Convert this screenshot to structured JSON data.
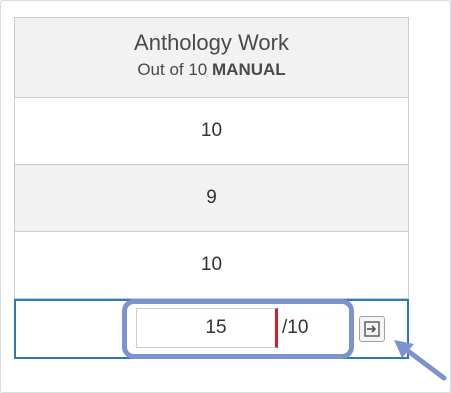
{
  "column": {
    "title": "Anthology Work",
    "subtitle_prefix": "Out of 10",
    "subtitle_mode": "MANUAL"
  },
  "rows": [
    "10",
    "9",
    "10"
  ],
  "edit": {
    "value": "15",
    "denominator": "/10",
    "submit_icon": "arrow-into-box-icon"
  },
  "colors": {
    "focus_border": "#2b7abc",
    "highlight": "#7d93cf",
    "error": "#d11f2e"
  }
}
